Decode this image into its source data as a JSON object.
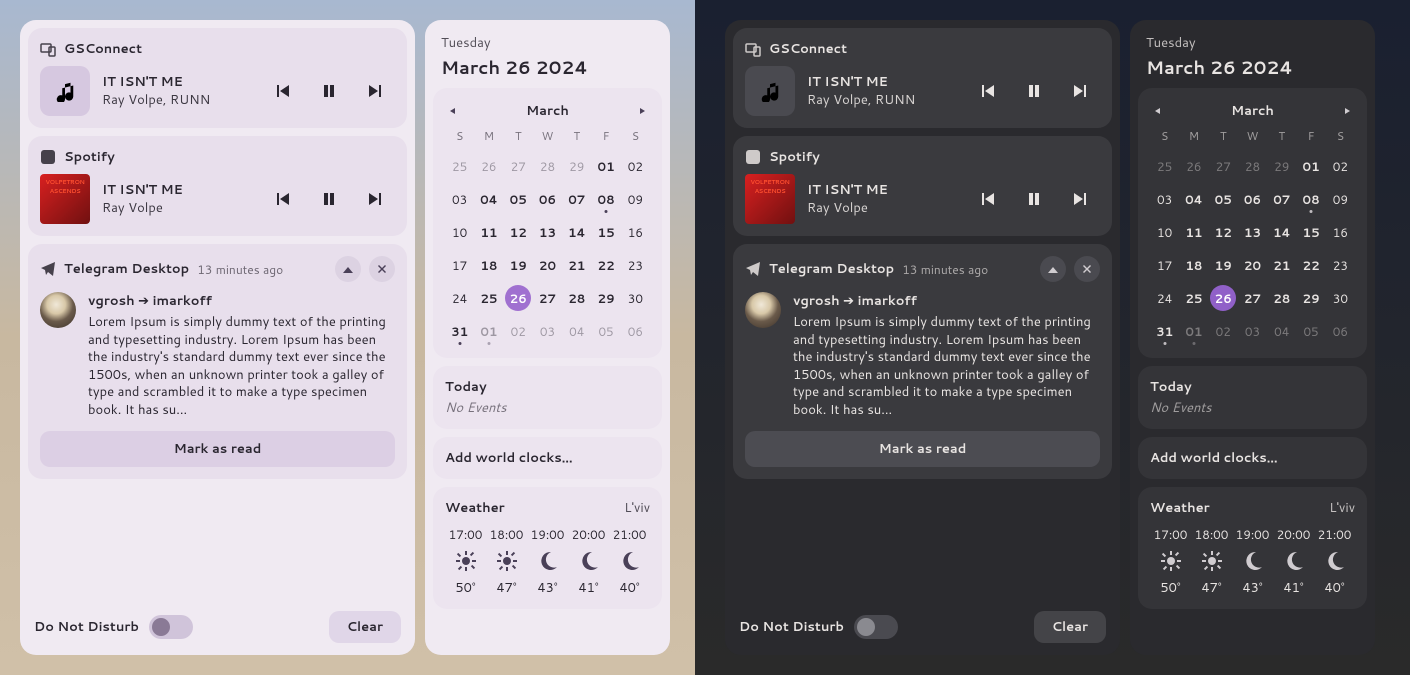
{
  "date": {
    "weekday": "Tuesday",
    "full": "March 26 2024"
  },
  "media": [
    {
      "app": "GSConnect",
      "app_icon": "devices-icon",
      "art": "generic",
      "title": "IT ISN'T ME",
      "artist": "Ray Volpe, RUNN"
    },
    {
      "app": "Spotify",
      "app_icon": "spotify-icon",
      "art": "album",
      "title": "IT ISN'T ME",
      "artist": "Ray Volpe"
    }
  ],
  "notification": {
    "app": "Telegram Desktop",
    "time": "13 minutes ago",
    "sender": "vgrosh ➔ imarkoff",
    "body": "Lorem Ipsum is simply dummy text of the printing and typesetting industry. Lorem Ipsum has been the industry's standard dummy text ever since the 1500s, when an unknown printer took a galley of type and scrambled it to make a type specimen book. It has su...",
    "action": "Mark as read"
  },
  "dnd_label": "Do Not Disturb",
  "clear_label": "Clear",
  "calendar": {
    "month": "March",
    "dow": [
      "S",
      "M",
      "T",
      "W",
      "T",
      "F",
      "S"
    ],
    "days": [
      {
        "n": "25",
        "dim": true
      },
      {
        "n": "26",
        "dim": true
      },
      {
        "n": "27",
        "dim": true
      },
      {
        "n": "28",
        "dim": true
      },
      {
        "n": "29",
        "dim": true
      },
      {
        "n": "01",
        "bold": true
      },
      {
        "n": "02"
      },
      {
        "n": "03"
      },
      {
        "n": "04",
        "bold": true
      },
      {
        "n": "05",
        "bold": true
      },
      {
        "n": "06",
        "bold": true
      },
      {
        "n": "07",
        "bold": true
      },
      {
        "n": "08",
        "bold": true,
        "dot": true
      },
      {
        "n": "09"
      },
      {
        "n": "10"
      },
      {
        "n": "11",
        "bold": true
      },
      {
        "n": "12",
        "bold": true
      },
      {
        "n": "13",
        "bold": true
      },
      {
        "n": "14",
        "bold": true
      },
      {
        "n": "15",
        "bold": true
      },
      {
        "n": "16"
      },
      {
        "n": "17"
      },
      {
        "n": "18",
        "bold": true
      },
      {
        "n": "19",
        "bold": true
      },
      {
        "n": "20",
        "bold": true
      },
      {
        "n": "21",
        "bold": true
      },
      {
        "n": "22",
        "bold": true
      },
      {
        "n": "23"
      },
      {
        "n": "24"
      },
      {
        "n": "25",
        "bold": true
      },
      {
        "n": "26",
        "today": true
      },
      {
        "n": "27",
        "bold": true
      },
      {
        "n": "28",
        "bold": true
      },
      {
        "n": "29",
        "bold": true
      },
      {
        "n": "30"
      },
      {
        "n": "31",
        "bold": true,
        "dot": true
      },
      {
        "n": "01",
        "dim": true,
        "bold": true,
        "dot": true
      },
      {
        "n": "02",
        "dim": true
      },
      {
        "n": "03",
        "dim": true
      },
      {
        "n": "04",
        "dim": true
      },
      {
        "n": "05",
        "dim": true
      },
      {
        "n": "06",
        "dim": true
      }
    ]
  },
  "events": {
    "title": "Today",
    "empty": "No Events"
  },
  "world_clocks": "Add world clocks…",
  "weather": {
    "title": "Weather",
    "location": "L'viv",
    "hours": [
      {
        "time": "17:00",
        "icon": "sun",
        "temp": "50°"
      },
      {
        "time": "18:00",
        "icon": "sun",
        "temp": "47°"
      },
      {
        "time": "19:00",
        "icon": "moon",
        "temp": "43°"
      },
      {
        "time": "20:00",
        "icon": "moon",
        "temp": "41°"
      },
      {
        "time": "21:00",
        "icon": "moon",
        "temp": "40°"
      }
    ]
  }
}
